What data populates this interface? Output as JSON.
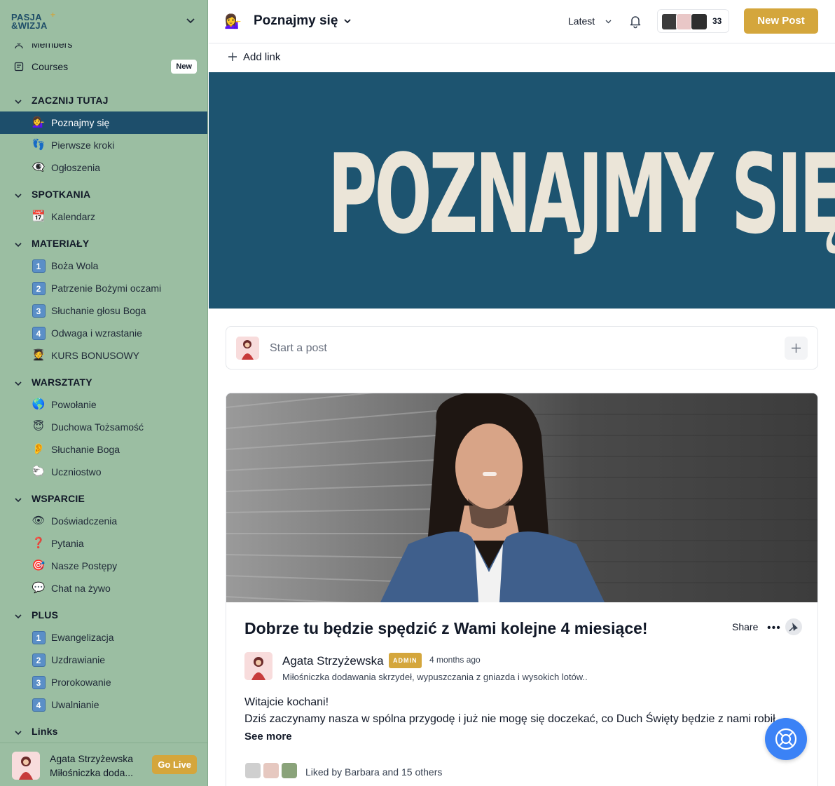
{
  "sidebar": {
    "logo_line1": "PASJA",
    "logo_line2": "&WIZJA",
    "top_items": [
      {
        "label": "Members",
        "icon": "members-icon"
      },
      {
        "label": "Courses",
        "icon": "courses-icon",
        "badge": "New"
      }
    ],
    "sections": [
      {
        "title": "ZACZNIJ TUTAJ",
        "items": [
          {
            "emoji": "💁‍♀️",
            "label": "Poznajmy się",
            "active": true
          },
          {
            "emoji": "👣",
            "label": "Pierwsze kroki"
          },
          {
            "emoji": "👁‍🗨",
            "label": "Ogłoszenia"
          }
        ]
      },
      {
        "title": "SPOTKANIA",
        "items": [
          {
            "emoji": "📆",
            "label": "Kalendarz"
          }
        ]
      },
      {
        "title": "MATERIAŁY",
        "items": [
          {
            "emoji": "1",
            "label": "Boża Wola"
          },
          {
            "emoji": "2",
            "label": "Patrzenie Bożymi oczami"
          },
          {
            "emoji": "3",
            "label": "Słuchanie głosu Boga"
          },
          {
            "emoji": "4",
            "label": "Odwaga i wzrastanie"
          },
          {
            "emoji": "🧑‍🎓",
            "label": "KURS BONUSOWY"
          }
        ]
      },
      {
        "title": "WARSZTATY",
        "items": [
          {
            "emoji": "🌎",
            "label": "Powołanie"
          },
          {
            "emoji": "😇",
            "label": "Duchowa Tożsamość"
          },
          {
            "emoji": "👂",
            "label": "Słuchanie Boga"
          },
          {
            "emoji": "🐑",
            "label": "Uczniostwo"
          }
        ]
      },
      {
        "title": "WSPARCIE",
        "items": [
          {
            "emoji": "👁",
            "label": "Doświadczenia"
          },
          {
            "emoji": "❓",
            "label": "Pytania"
          },
          {
            "emoji": "🎯",
            "label": "Nasze Postępy"
          },
          {
            "emoji": "💬",
            "label": "Chat na żywo"
          }
        ]
      },
      {
        "title": "PLUS",
        "items": [
          {
            "emoji": "1",
            "label": "Ewangelizacja"
          },
          {
            "emoji": "2",
            "label": "Uzdrawianie"
          },
          {
            "emoji": "3",
            "label": "Prorokowanie"
          },
          {
            "emoji": "4",
            "label": "Uwalnianie"
          }
        ]
      },
      {
        "title": "Links",
        "items": []
      }
    ],
    "footer": {
      "name": "Agata Strzyżewska",
      "subtitle": "Miłośniczka doda...",
      "go_live": "Go Live"
    }
  },
  "header": {
    "emoji": "💁‍♀️",
    "title": "Poznajmy się",
    "sort": "Latest",
    "member_count": "33",
    "new_post": "New Post"
  },
  "add_link": "Add link",
  "banner": {
    "text": "POZNAJMY SIĘ",
    "bg": "#1d5470",
    "fg": "#ebe5d8"
  },
  "composer": {
    "placeholder": "Start a post"
  },
  "post": {
    "title": "Dobrze tu będzie spędzić z Wami kolejne 4 miesiące!",
    "share": "Share",
    "author": "Agata Strzyżewska",
    "role": "ADMIN",
    "time": "4 months ago",
    "bio": "Miłośniczka dodawania skrzydeł, wypuszczania z gniazda i wysokich lotów..",
    "body_line1": "Witajcie kochani!",
    "body_line2": "Dziś zaczynamy nasza w spólna przygodę i już nie mogę się doczekać, co Duch Święty będzie z nami robił",
    "see_more": "See more",
    "liked_by": "Liked by Barbara and 15 others"
  },
  "colors": {
    "accent": "#d4a63c",
    "sidebar_bg": "#9bbea2",
    "active_item": "#1d4e6b",
    "help": "#3b82f6"
  }
}
